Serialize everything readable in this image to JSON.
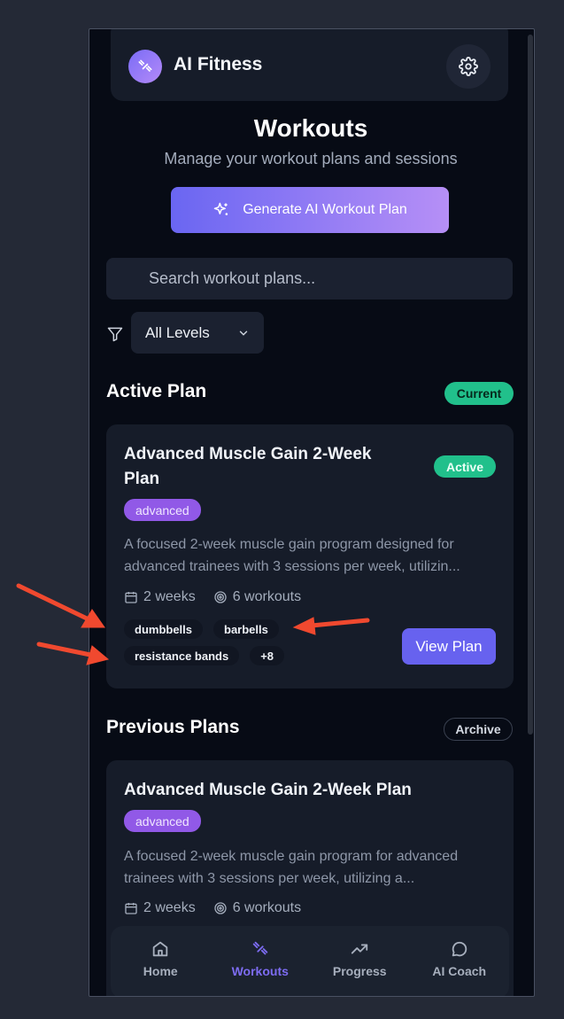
{
  "app": {
    "title": "AI Fitness"
  },
  "page": {
    "title": "Workouts",
    "subtitle": "Manage your workout plans and sessions",
    "generate_button": "Generate AI Workout Plan",
    "search_placeholder": "Search workout plans...",
    "level_filter": "All Levels"
  },
  "active_section": {
    "title": "Active Plan",
    "badge": "Current",
    "card": {
      "title_line1": "Advanced Muscle Gain 2-Week",
      "title_line2": "Plan",
      "status": "Active",
      "level": "advanced",
      "desc_line1": "A focused 2-week muscle gain program designed for",
      "desc_line2": "advanced trainees with 3 sessions per week, utilizin...",
      "duration": "2 weeks",
      "workouts": "6 workouts",
      "tags": [
        "dumbbells",
        "barbells",
        "resistance bands",
        "+8"
      ],
      "view_button": "View Plan"
    }
  },
  "previous_section": {
    "title": "Previous Plans",
    "badge": "Archive",
    "card": {
      "title": "Advanced Muscle Gain 2-Week Plan",
      "level": "advanced",
      "desc_line1": "A focused 2-week muscle gain program for advanced",
      "desc_line2": "trainees with 3 sessions per week, utilizing a...",
      "duration": "2 weeks",
      "workouts": "6 workouts"
    }
  },
  "nav": {
    "items": [
      {
        "label": "Home"
      },
      {
        "label": "Workouts"
      },
      {
        "label": "Progress"
      },
      {
        "label": "AI Coach"
      }
    ],
    "active": "Workouts"
  },
  "colors": {
    "accent": "#6762ef",
    "success": "#21c08b",
    "level_tag": "#9159e7",
    "annotation_arrow": "#f0492f"
  }
}
